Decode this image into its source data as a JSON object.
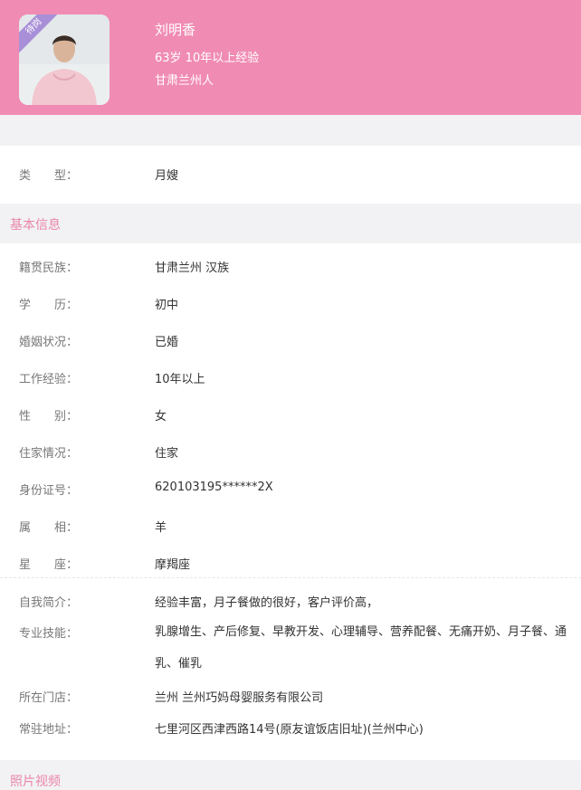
{
  "profile": {
    "badge": "待岗",
    "name": "刘明香",
    "age_experience": "63岁 10年以上经验",
    "origin": "甘肃兰州人"
  },
  "type_row": {
    "label": "类　　型：",
    "value": "月嫂"
  },
  "sections": {
    "basic_title": "基本信息",
    "media_title": "照片视频"
  },
  "basic_info": [
    {
      "label": "籍贯民族：",
      "value": "甘肃兰州 汉族"
    },
    {
      "label": "学　　历：",
      "value": "初中"
    },
    {
      "label": "婚姻状况：",
      "value": "已婚"
    },
    {
      "label": "工作经验：",
      "value": "10年以上"
    },
    {
      "label": "性　　别：",
      "value": "女"
    },
    {
      "label": "住家情况：",
      "value": "住家"
    },
    {
      "label": "身份证号：",
      "value": "620103195******2X"
    },
    {
      "label": "属　　相：",
      "value": "羊"
    },
    {
      "label": "星　　座：",
      "value": "摩羯座"
    }
  ],
  "details": {
    "intro_label": "自我简介：",
    "intro_value": "经验丰富，月子餐做的很好，客户评价高，",
    "skills_label": "专业技能：",
    "skills_value": "乳腺增生、产后修复、早教开发、心理辅导、营养配餐、无痛开奶、月子餐、通乳、催乳",
    "store_label": "所在门店：",
    "store_value": "兰州 兰州巧妈母婴服务有限公司",
    "address_label": "常驻地址：",
    "address_value": "七里河区西津西路14号(原友谊饭店旧址)(兰州中心)"
  },
  "colors": {
    "header_bg": "#f08cb3",
    "badge_bg": "#a88fd8",
    "section_title": "#ea86a9"
  }
}
